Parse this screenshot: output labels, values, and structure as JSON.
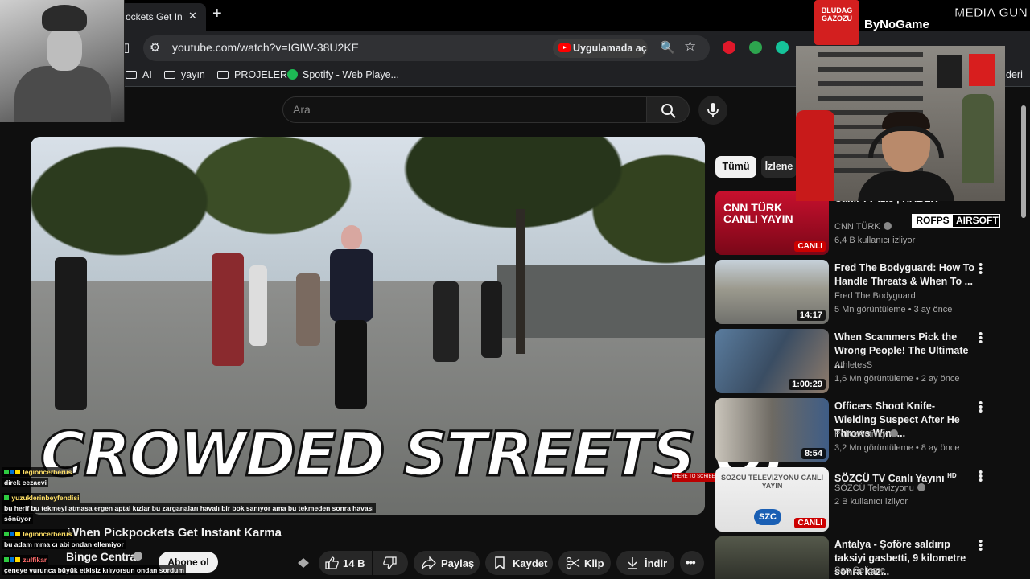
{
  "browser": {
    "tab_title": "ockets Get Ins",
    "url": "youtube.com/watch?v=IGIW-38U2KE",
    "open_in_app": "Uygulamada aç",
    "bookmarks": [
      "AI",
      "yayın",
      "PROJELER",
      "Spotify - Web Playe..."
    ],
    "bookmarks_overflow": "deri"
  },
  "search": {
    "placeholder": "Ara"
  },
  "video": {
    "caption": "CROWDED STREETS OF",
    "subscribe_badge": "HERE TO SCRIBE",
    "title": "When Pickpockets Get Instant Karma",
    "channel": "Binge Central",
    "subscribe": "Abone ol",
    "likes": "14 B",
    "share": "Paylaş",
    "save": "Kaydet",
    "clip": "Klip",
    "download": "İndir"
  },
  "chips": [
    "Tümü",
    "İzlene"
  ],
  "recommendations": [
    {
      "title": "Canlı TV izle | HABER",
      "channel": "CNN TÜRK",
      "meta": "6,4 B kullanıcı izliyor",
      "badge": "CANLI",
      "thumb_text": "CNN TÜRK CANLI YAYIN"
    },
    {
      "title": "Fred The Bodyguard: How To Handle Threats & When To ...",
      "channel": "Fred The Bodyguard",
      "meta": "5 Mn görüntüleme • 3 ay önce",
      "duration": "14:17"
    },
    {
      "title": "When Scammers Pick the Wrong People! The Ultimate ...",
      "channel": "AthletesS",
      "meta": "1,6 Mn görüntüleme • 2 ay önce",
      "duration": "1:00:29"
    },
    {
      "title": "Officers Shoot Knife-Wielding Suspect After He Throws Wine...",
      "channel": "PoliceActivity",
      "meta": "3,2 Mn görüntüleme • 8 ay önce",
      "duration": "8:54"
    },
    {
      "title": "SÖZCÜ TV Canlı Yayını",
      "hd": "HD",
      "channel": "SÖZCÜ Televizyonu",
      "meta": "2 B kullanıcı izliyor",
      "badge": "CANLI",
      "thumb_text": "SÖZCÜ TELEVİZYONU CANLI YAYIN",
      "logo": "SZC"
    },
    {
      "title": "Antalya - Şoföre saldırıp taksiyi gasbetti, 9 kilometre sonra kaz...",
      "channel": "Son Gelişme",
      "meta": ""
    }
  ],
  "overlay": {
    "sponsor_bludag": "BLUDAG GAZOZU",
    "sponsor_bynogame": "ByNoGame",
    "sponsor_media": "MEDIA GUN",
    "rofps_a": "ROFPS",
    "rofps_b": "AIRSOFT"
  },
  "chat": [
    {
      "user": "legioncerberus",
      "message": "direk cezaevi"
    },
    {
      "user": "yuzuklerinbeyfendisi",
      "message": "bu herif bu tekmeyi atmasa ergen aptal kızlar bu zarganaları havalı bir bok sanıyor ama bu tekmeden sonra havası"
    },
    {
      "user": "",
      "message": "sönüyor"
    },
    {
      "user": "legioncerberus",
      "message": "bu adam mma cı abi ondan ellemiyor"
    },
    {
      "user": "zulfikar",
      "message": "çeneye vurunca büyük etkisiz kılıyorsun ondan sordum"
    }
  ],
  "colors": {
    "accent": "#ff0000",
    "live": "#cc0000",
    "bg": "#0f0f0f"
  }
}
